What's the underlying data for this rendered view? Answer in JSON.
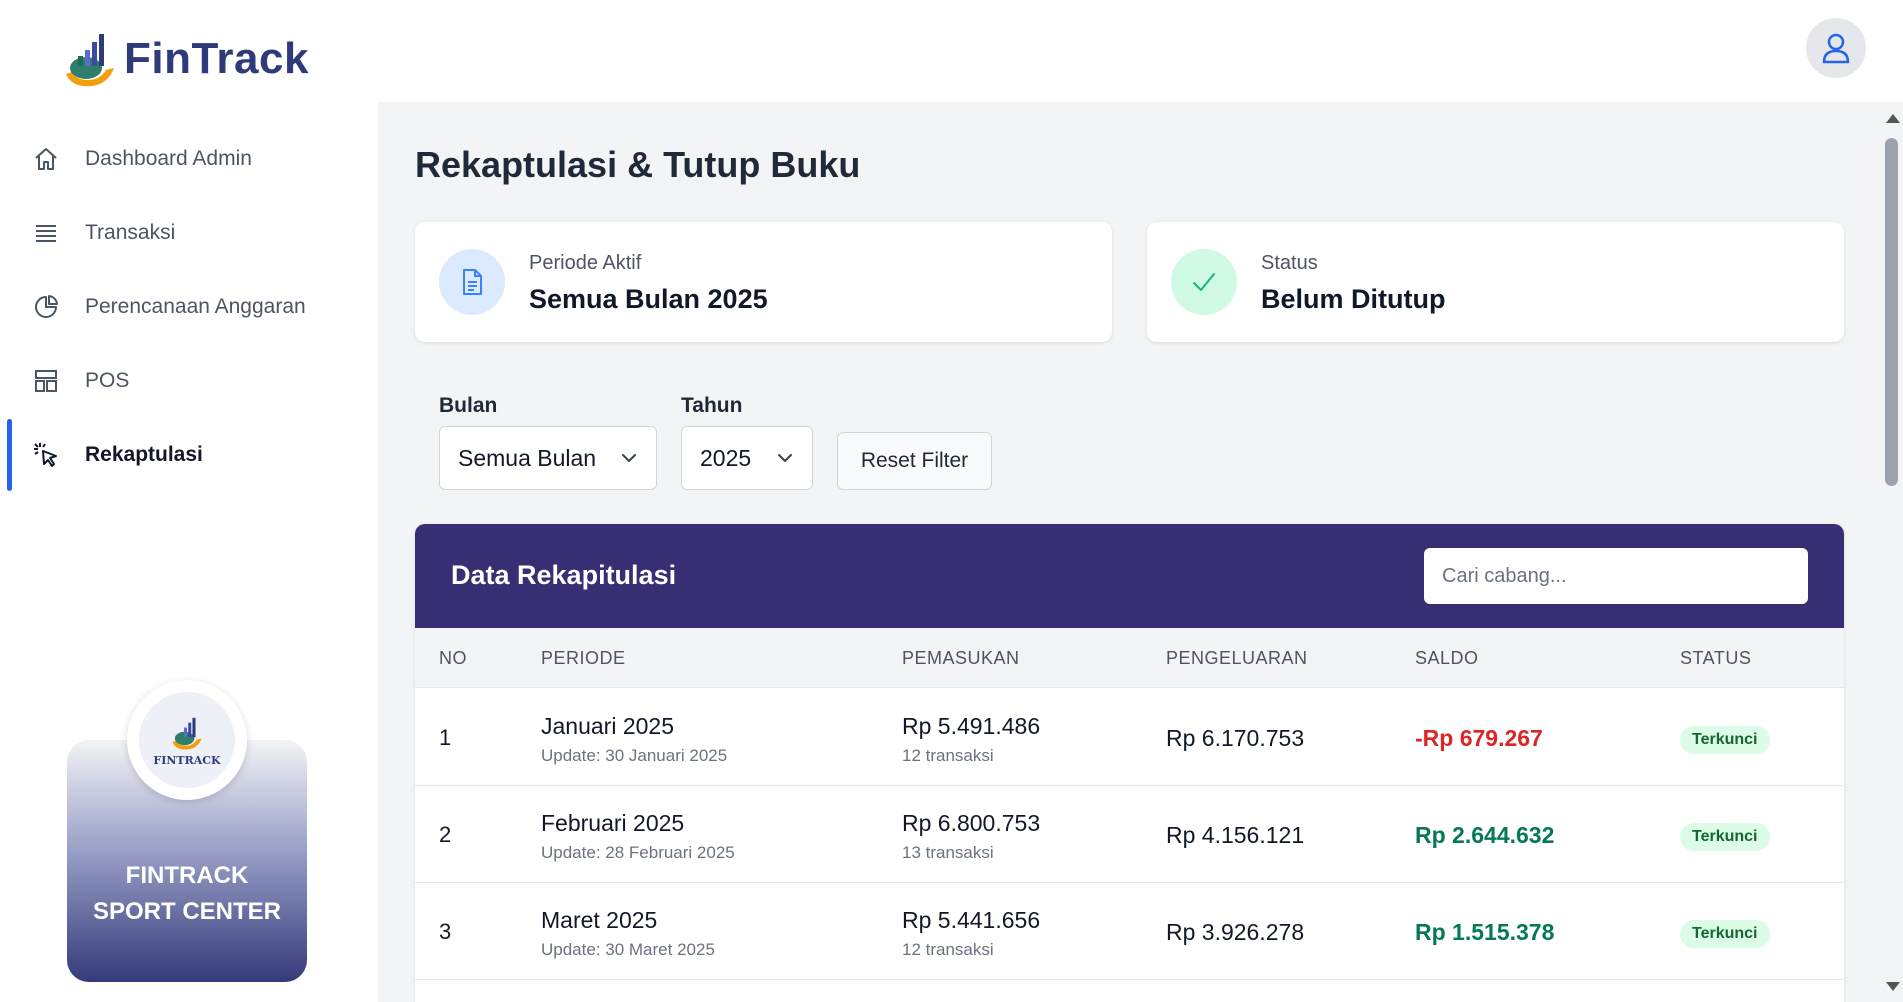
{
  "app": {
    "name": "FinTrack",
    "brand_card": {
      "badge_text": "FINTRACK",
      "name_line1": "FINTRACK",
      "name_line2": "SPORT CENTER"
    }
  },
  "sidebar": {
    "items": [
      {
        "label": "Dashboard Admin",
        "icon": "home-icon"
      },
      {
        "label": "Transaksi",
        "icon": "list-icon"
      },
      {
        "label": "Perencanaan Anggaran",
        "icon": "pie-chart-icon"
      },
      {
        "label": "POS",
        "icon": "store-icon"
      },
      {
        "label": "Rekaptulasi",
        "icon": "cursor-click-icon",
        "active": true
      }
    ]
  },
  "page": {
    "title": "Rekaptulasi & Tutup Buku",
    "cards": {
      "period": {
        "label": "Periode Aktif",
        "value": "Semua Bulan 2025",
        "icon": "document-icon"
      },
      "status": {
        "label": "Status",
        "value": "Belum Ditutup",
        "icon": "check-icon"
      }
    },
    "filters": {
      "month_label": "Bulan",
      "month_value": "Semua Bulan",
      "year_label": "Tahun",
      "year_value": "2025",
      "reset_label": "Reset Filter"
    }
  },
  "table": {
    "title": "Data Rekapitulasi",
    "search_placeholder": "Cari cabang...",
    "columns": [
      "NO",
      "PERIODE",
      "PEMASUKAN",
      "PENGELUARAN",
      "SALDO",
      "STATUS"
    ],
    "rows": [
      {
        "no": "1",
        "period": "Januari 2025",
        "update": "Update: 30 Januari 2025",
        "income": "Rp 5.491.486",
        "tx": "12 transaksi",
        "expense": "Rp 6.170.753",
        "balance": "-Rp 679.267",
        "balance_color": "#dc2626",
        "status": "Terkunci"
      },
      {
        "no": "2",
        "period": "Februari 2025",
        "update": "Update: 28 Februari 2025",
        "income": "Rp 6.800.753",
        "tx": "13 transaksi",
        "expense": "Rp 4.156.121",
        "balance": "Rp 2.644.632",
        "balance_color": "#047857",
        "status": "Terkunci"
      },
      {
        "no": "3",
        "period": "Maret 2025",
        "update": "Update: 30 Maret 2025",
        "income": "Rp 5.441.656",
        "tx": "12 transaksi",
        "expense": "Rp 3.926.278",
        "balance": "Rp 1.515.378",
        "balance_color": "#047857",
        "status": "Terkunci"
      }
    ]
  },
  "colors": {
    "accent": "#2563eb",
    "table_header": "#372e74",
    "positive": "#047857",
    "negative": "#dc2626"
  }
}
